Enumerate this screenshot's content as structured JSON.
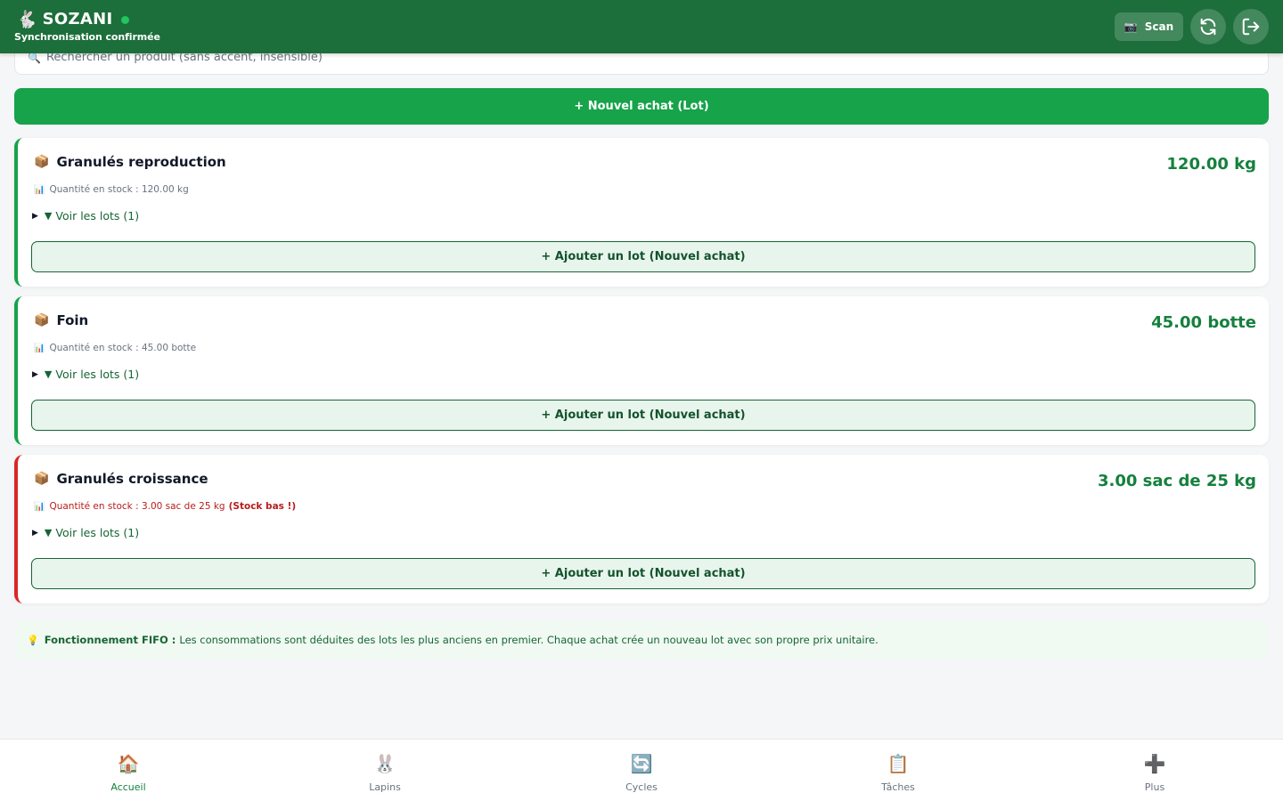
{
  "header": {
    "brand_icon": "🐇",
    "brand_name": "SOZANI",
    "sync_status": "Synchronisation confirmée",
    "scan_icon": "📷",
    "scan_label": "Scan",
    "status_color": "#22c55e",
    "brand_color": "#1c6e3a"
  },
  "search": {
    "icon": "🔍",
    "placeholder": "Rechercher un produit (sans accent, insensible)"
  },
  "new_purchase_label": "+ Nouvel achat (Lot)",
  "products": [
    {
      "icon": "📦",
      "name": "Granulés reproduction",
      "quantity": "120.00 kg",
      "stock_icon": "📊",
      "stock_text": "Quantité en stock : 120.00 kg",
      "lots_label": "Voir les lots (1)",
      "add_lot_label": "+ Ajouter un lot (Nouvel achat)"
    },
    {
      "icon": "📦",
      "name": "Foin",
      "quantity": "45.00 botte",
      "stock_icon": "📊",
      "stock_text": "Quantité en stock : 45.00 botte",
      "lots_label": "Voir les lots (1)",
      "add_lot_label": "+ Ajouter un lot (Nouvel achat)"
    },
    {
      "icon": "📦",
      "name": "Granulés croissance",
      "quantity": "3.00 sac de 25 kg",
      "stock_icon": "📊",
      "stock_text": "Quantité en stock : 3.00 sac de 25 kg",
      "stock_warning": "(Stock bas !)",
      "lots_label": "Voir les lots (1)",
      "add_lot_label": "+ Ajouter un lot (Nouvel achat)"
    }
  ],
  "fifo": {
    "icon": "💡",
    "title": "Fonctionnement FIFO :",
    "text": "Les consommations sont déduites des lots les plus anciens en premier. Chaque achat crée un nouveau lot avec son propre prix unitaire."
  },
  "nav": [
    {
      "icon": "🏠",
      "label": "Accueil"
    },
    {
      "icon": "🐰",
      "label": "Lapins"
    },
    {
      "icon": "🔄",
      "label": "Cycles"
    },
    {
      "icon": "📋",
      "label": "Tâches"
    },
    {
      "icon": "➕",
      "label": "Plus"
    }
  ]
}
